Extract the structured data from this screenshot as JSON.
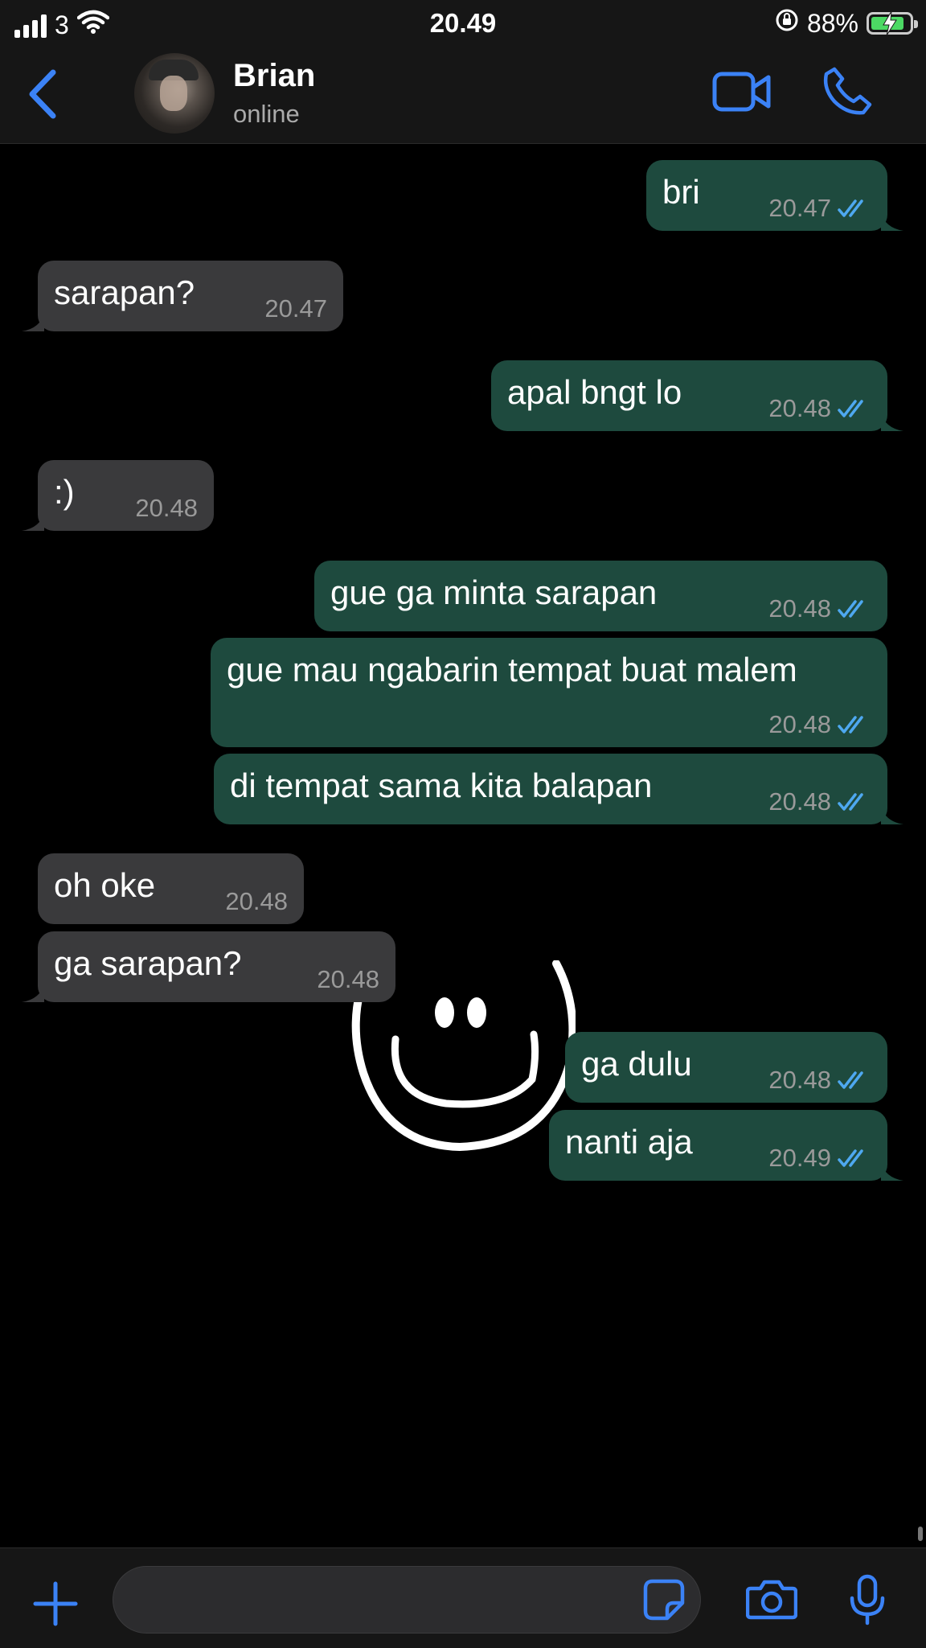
{
  "status_bar": {
    "carrier": "3",
    "time": "20.49",
    "battery": "88%",
    "icons": [
      "signal-icon",
      "wifi-icon",
      "orientation-lock-icon",
      "battery-charging-icon"
    ]
  },
  "header": {
    "contact_name": "Brian",
    "presence": "online",
    "icons": [
      "back-chevron-icon",
      "video-call-icon",
      "phone-call-icon"
    ]
  },
  "messages": [
    {
      "dir": "out",
      "text": "bri",
      "time": "20.47"
    },
    {
      "dir": "in",
      "text": "sarapan?",
      "time": "20.47"
    },
    {
      "dir": "out",
      "text": "apal bngt lo",
      "time": "20.48"
    },
    {
      "dir": "in",
      "text": ":)",
      "time": "20.48"
    },
    {
      "dir": "out",
      "text": "gue ga minta sarapan",
      "time": "20.48"
    },
    {
      "dir": "out",
      "text": "gue mau ngabarin tempat buat malem",
      "time": "20.48"
    },
    {
      "dir": "out",
      "text": "di tempat sama kita balapan",
      "time": "20.48"
    },
    {
      "dir": "in",
      "text": "oh oke",
      "time": "20.48"
    },
    {
      "dir": "in",
      "text": "ga sarapan?",
      "time": "20.48"
    },
    {
      "dir": "out",
      "text": "ga dulu",
      "time": "20.48"
    },
    {
      "dir": "out",
      "text": "nanti aja",
      "time": "20.49"
    }
  ],
  "input_bar": {
    "message_placeholder": "",
    "icons": [
      "plus-icon",
      "sticker-icon",
      "camera-icon",
      "microphone-icon"
    ]
  },
  "colors": {
    "accent": "#3b82f6",
    "outgoing_bubble": "#1e4a3e",
    "incoming_bubble": "#3a3a3c",
    "read_ticks": "#4ea8f0",
    "background": "#000000"
  }
}
